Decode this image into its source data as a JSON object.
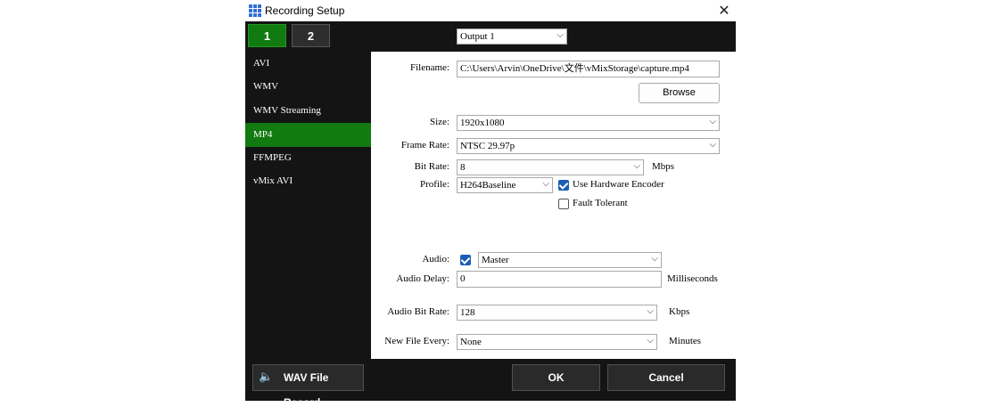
{
  "window": {
    "title": "Recording Setup",
    "close_glyph": "✕"
  },
  "tabs": [
    {
      "label": "1"
    },
    {
      "label": "2"
    }
  ],
  "output_select": {
    "value": "Output 1"
  },
  "sidebar": {
    "items": [
      {
        "label": "AVI"
      },
      {
        "label": "WMV"
      },
      {
        "label": "WMV Streaming"
      },
      {
        "label": "MP4"
      },
      {
        "label": "FFMPEG"
      },
      {
        "label": "vMix AVI"
      }
    ],
    "selected": "MP4"
  },
  "form": {
    "filename_label": "Filename:",
    "filename_value": "C:\\Users\\Arvin\\OneDrive\\文件\\vMixStorage\\capture.mp4",
    "browse_label": "Browse",
    "size_label": "Size:",
    "size_value": "1920x1080",
    "framerate_label": "Frame Rate:",
    "framerate_value": "NTSC 29.97p",
    "bitrate_label": "Bit Rate:",
    "bitrate_value": "8",
    "bitrate_unit": "Mbps",
    "profile_label": "Profile:",
    "profile_value": "H264Baseline",
    "hw_encoder_label": "Use Hardware Encoder",
    "hw_encoder_checked": true,
    "fault_tolerant_label": "Fault Tolerant",
    "fault_tolerant_checked": false,
    "audio_label": "Audio:",
    "audio_checked": true,
    "audio_value": "Master",
    "audio_delay_label": "Audio Delay:",
    "audio_delay_value": "0",
    "audio_delay_unit": "Milliseconds",
    "audio_bitrate_label": "Audio Bit Rate:",
    "audio_bitrate_value": "128",
    "audio_bitrate_unit": "Kbps",
    "new_file_label": "New File Every:",
    "new_file_value": "None",
    "new_file_unit": "Minutes"
  },
  "footer": {
    "wav_label": "WAV File Record",
    "ok_label": "OK",
    "cancel_label": "Cancel"
  },
  "icons": {
    "chevron": "⌵",
    "speaker": "🔈"
  },
  "colors": {
    "accent_green": "#117a11",
    "dark_bg": "#141414",
    "checkbox_blue": "#1a5fb4"
  }
}
